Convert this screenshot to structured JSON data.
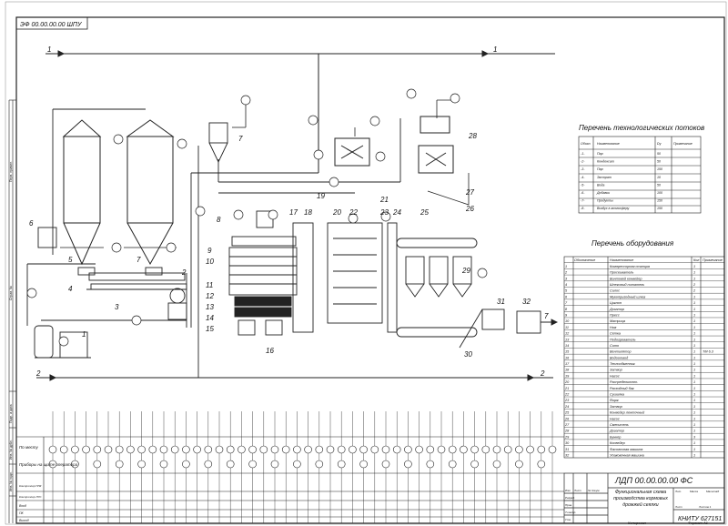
{
  "sheet": {
    "corner_code": "ЭФ 00.00.00.00 ШПУ",
    "title_code": "ЛДП 00.00.00.00 ФС",
    "title_name": "Функциональная схема производства кормовых дрожжей сеялки",
    "org": "КНИТУ 627151"
  },
  "flows": {
    "f1_left": "1",
    "f1_right": "1",
    "f2_left": "2",
    "f2_right": "2",
    "f7": "7"
  },
  "equipment_labels": [
    "1",
    "2",
    "3",
    "4",
    "5",
    "6",
    "7",
    "7",
    "8",
    "9",
    "10",
    "11",
    "12",
    "13",
    "14",
    "15",
    "16",
    "17",
    "18",
    "19",
    "20",
    "21",
    "22",
    "23",
    "24",
    "25",
    "26",
    "27",
    "28",
    "29",
    "30",
    "31",
    "32"
  ],
  "streams_table": {
    "title": "Перечень технологических потоков",
    "headers": [
      "Обозн.",
      "Наименование",
      "Dy",
      "Примечание"
    ],
    "rows": [
      [
        "-1-",
        "Пар",
        "50",
        ""
      ],
      [
        "-2-",
        "Конденсат",
        "50",
        ""
      ],
      [
        "-3-",
        "Пар",
        "150",
        ""
      ],
      [
        "-4-",
        "Экстрат",
        "10",
        ""
      ],
      [
        "-5-",
        "Вода",
        "50",
        ""
      ],
      [
        "-6-",
        "Добавки",
        "100",
        ""
      ],
      [
        "-7-",
        "Продукты",
        "150",
        ""
      ],
      [
        "-8-",
        "Воздух в атмосферу",
        "150",
        ""
      ]
    ]
  },
  "equipment_table": {
    "title": "Перечень оборудования",
    "headers": [
      "Обозначение",
      "Наименование",
      "Кол",
      "Примечание"
    ],
    "rows": [
      [
        "1",
        "Компрессорная станция",
        "1",
        ""
      ],
      [
        "2",
        "Просеиватель",
        "1",
        ""
      ],
      [
        "3",
        "Винтовой конвейер",
        "1",
        ""
      ],
      [
        "4",
        "Шнековый питатель",
        "2",
        ""
      ],
      [
        "5",
        "Силос",
        "2",
        ""
      ],
      [
        "6",
        "Мукопригодный шлюз",
        "1",
        ""
      ],
      [
        "7",
        "Циклон",
        "1",
        ""
      ],
      [
        "8",
        "Дозатор",
        "1",
        ""
      ],
      [
        "9",
        "Пресс",
        "1",
        ""
      ],
      [
        "10",
        "Матрица",
        "1",
        ""
      ],
      [
        "11",
        "Нож",
        "1",
        ""
      ],
      [
        "12",
        "Сетка",
        "1",
        ""
      ],
      [
        "13",
        "Подогреватель",
        "1",
        ""
      ],
      [
        "14",
        "Сито",
        "1",
        ""
      ],
      [
        "15",
        "Вентилятор",
        "1",
        "ТМ 6.3"
      ],
      [
        "16",
        "Водоотвод",
        "1",
        ""
      ],
      [
        "17",
        "Теплообменник",
        "1",
        ""
      ],
      [
        "18",
        "Затвор",
        "1",
        ""
      ],
      [
        "19",
        "Насос",
        "1",
        ""
      ],
      [
        "20",
        "Распределитель",
        "1",
        ""
      ],
      [
        "21",
        "Расходный бак",
        "1",
        ""
      ],
      [
        "22",
        "Сушилка",
        "1",
        ""
      ],
      [
        "23",
        "Ящик",
        "1",
        ""
      ],
      [
        "24",
        "Затвор",
        "1",
        ""
      ],
      [
        "25",
        "Конвейер ленточный",
        "1",
        ""
      ],
      [
        "26",
        "Насос",
        "1",
        ""
      ],
      [
        "27",
        "Смеситель",
        "1",
        ""
      ],
      [
        "28",
        "Дозатор",
        "1",
        ""
      ],
      [
        "29",
        "Бункер",
        "3",
        ""
      ],
      [
        "30",
        "Конвейер",
        "1",
        ""
      ],
      [
        "31",
        "Фасовочная машина",
        "1",
        ""
      ],
      [
        "32",
        "Упаковочная машина",
        "1",
        ""
      ]
    ]
  },
  "control_rows": {
    "local": "По месту",
    "panel": "Приборы на щите оператора",
    "row_a": "Контроллер ПЛК",
    "row_b": "Контроллер ЛУС",
    "row_c": "Вход",
    "row_d": "ПК",
    "row_e": "Выход"
  },
  "left_strip": [
    "Перв. примен.",
    "Справ. №",
    "Подп. и дата",
    "Инв. № дубл.",
    "Взам. инв. №",
    "Подп. и дата",
    "Инв. № подл."
  ],
  "title_block": {
    "labels": [
      "Изм",
      "Лист",
      "№ докум.",
      "Подп.",
      "Дата",
      "Разраб.",
      "Пров.",
      "Т.контр.",
      "Н.контр.",
      "Утв."
    ],
    "lit": "Лит.",
    "mass": "Масса",
    "scale": "Масштаб",
    "sheet_label": "Лист",
    "sheets_label": "Листов 1",
    "copied": "Копировал",
    "format": "Формат А1"
  }
}
